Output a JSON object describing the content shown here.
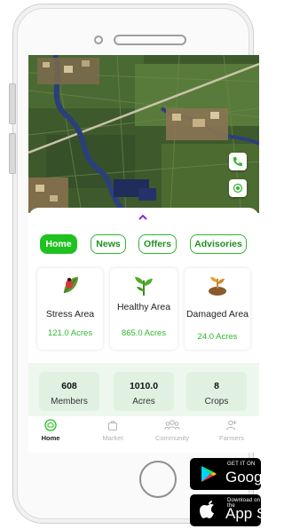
{
  "tabs": [
    {
      "label": "Home",
      "active": true
    },
    {
      "label": "News",
      "active": false
    },
    {
      "label": "Offers",
      "active": false
    },
    {
      "label": "Advisories",
      "active": false
    }
  ],
  "cards": [
    {
      "label": "Stress Area",
      "value": "121.0 Acres",
      "icon": "beetle-leaf-icon"
    },
    {
      "label": "Healthy Area",
      "value": "865.0 Acres",
      "icon": "plant-icon"
    },
    {
      "label": "Damaged Area",
      "value": "24.0 Acres",
      "icon": "damaged-plant-icon"
    }
  ],
  "stats": [
    {
      "number": "608",
      "label": "Members"
    },
    {
      "number": "1010.0",
      "label": "Acres"
    },
    {
      "number": "8",
      "label": "Crops"
    }
  ],
  "nav": [
    {
      "label": "Home",
      "active": true,
      "icon": "home-icon"
    },
    {
      "label": "Market",
      "active": false,
      "icon": "bag-icon"
    },
    {
      "label": "Community",
      "active": false,
      "icon": "community-icon"
    },
    {
      "label": "Farmers",
      "active": false,
      "icon": "add-person-icon"
    }
  ],
  "stores": {
    "google": {
      "small": "GET IT ON",
      "big": "Google Play"
    },
    "apple": {
      "small": "Download on the",
      "big": "App Store"
    }
  },
  "colors": {
    "accent": "#1fc21f",
    "accent_text": "#2eb82e",
    "stats_bg": "#edf7ee"
  }
}
